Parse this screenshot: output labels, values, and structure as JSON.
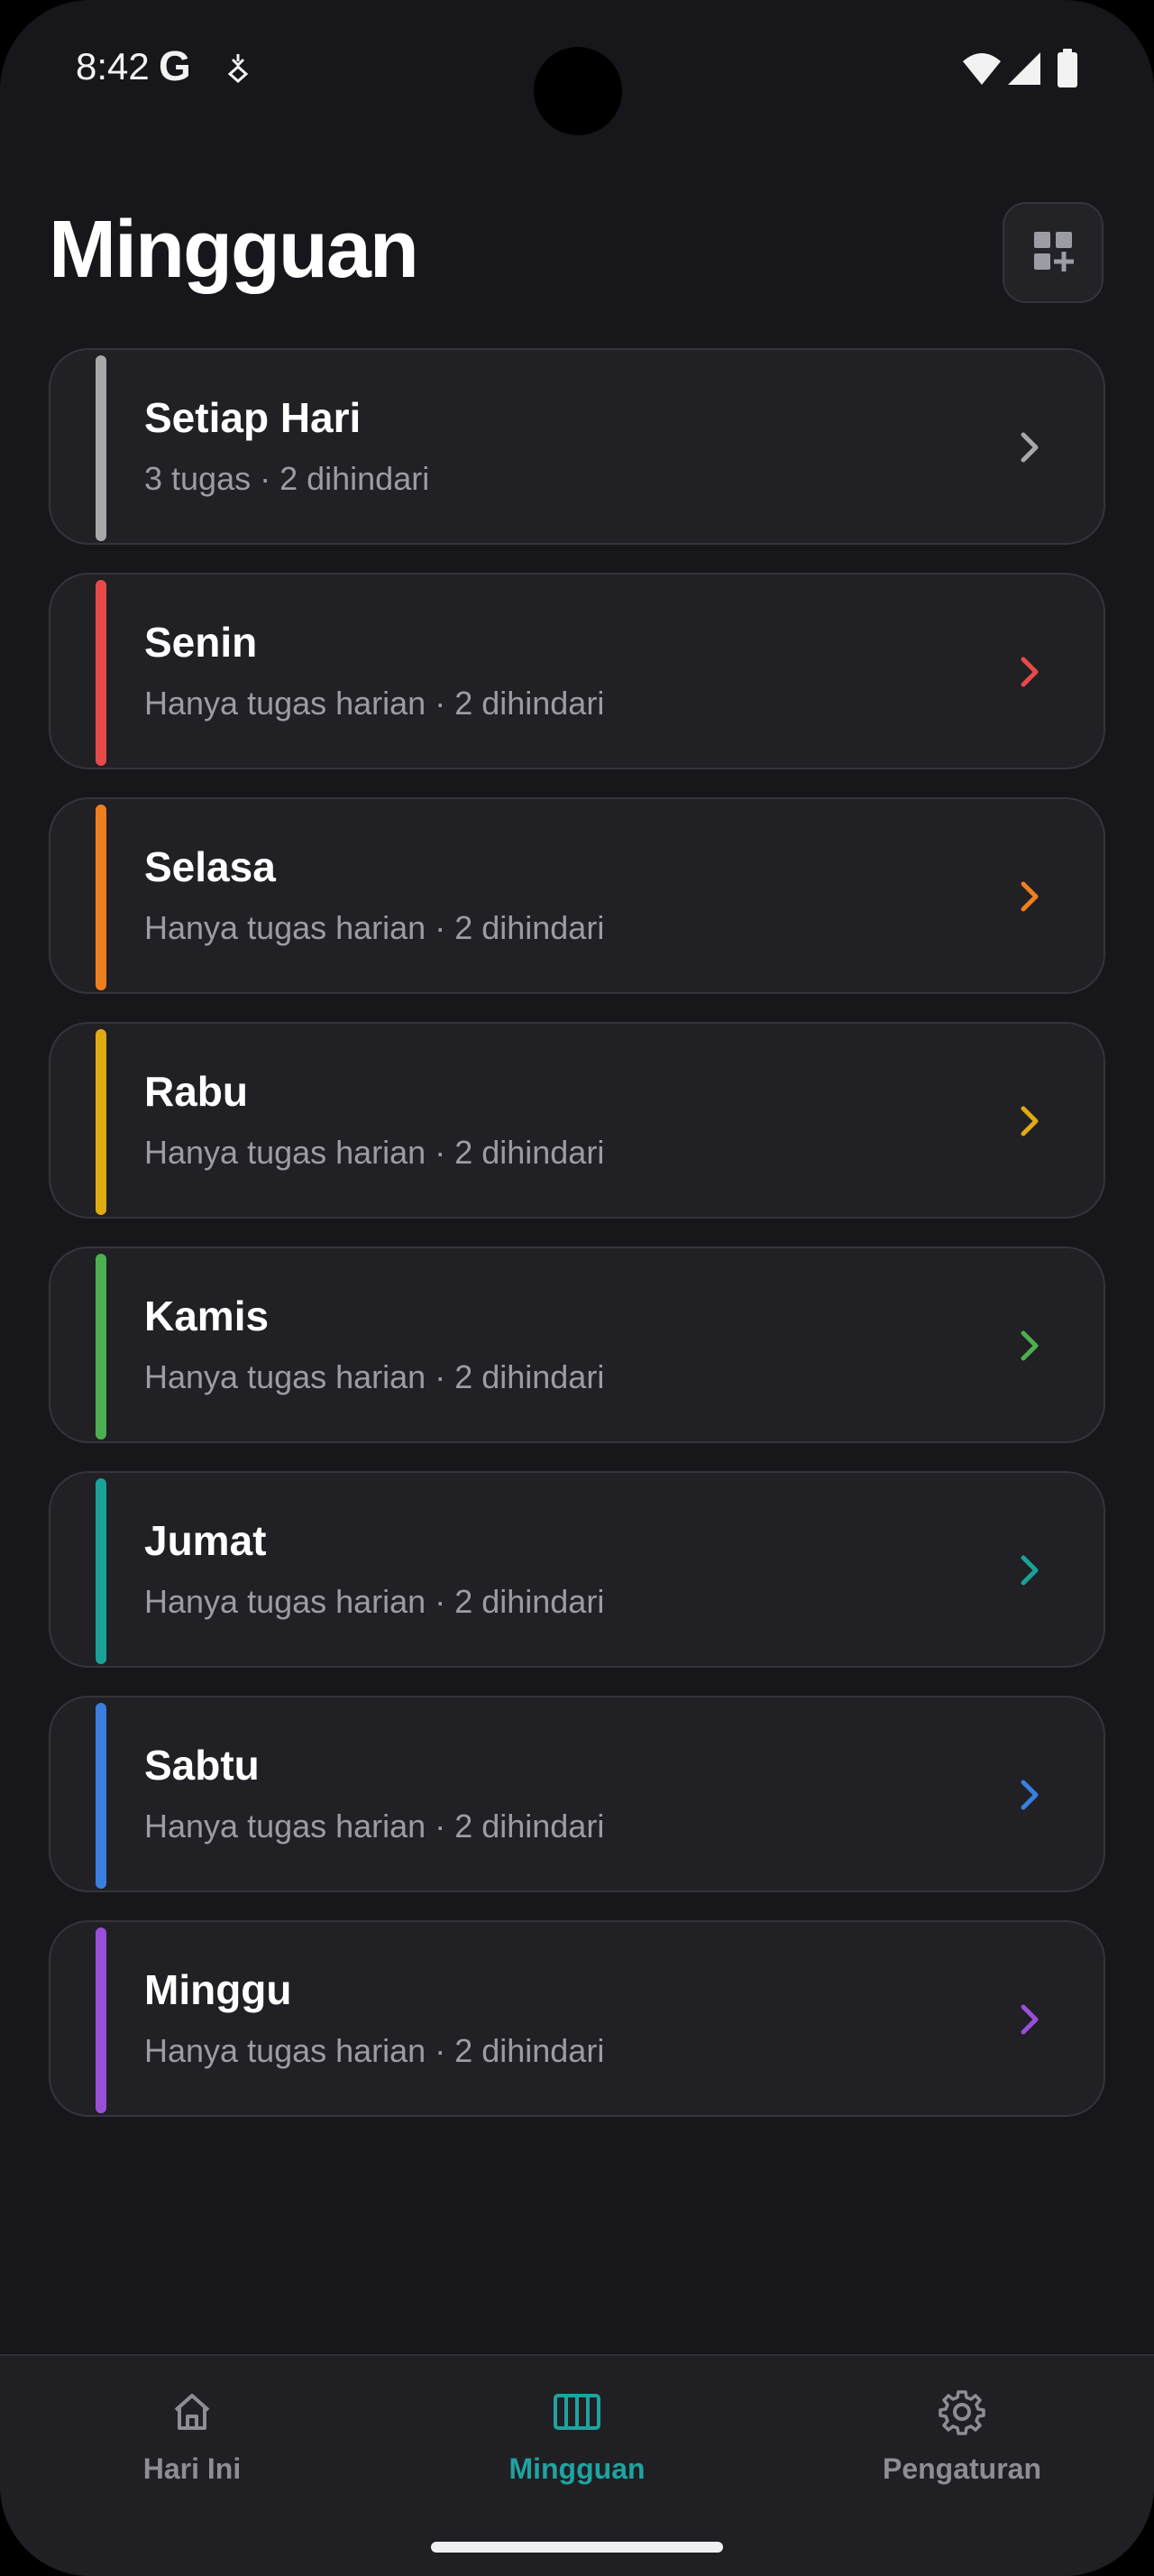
{
  "status_bar": {
    "time": "8:42",
    "google_icon": "G",
    "icons": [
      "google-icon",
      "notification-icon",
      "wifi-icon",
      "signal-icon",
      "battery-icon"
    ]
  },
  "header": {
    "title": "Mingguan",
    "action_icon": "add-widget-icon"
  },
  "days": [
    {
      "title": "Setiap Hari",
      "subtitle": "3 tugas · 2 dihindari",
      "color": "#a8a8a8"
    },
    {
      "title": "Senin",
      "subtitle": "Hanya tugas harian · 2 dihindari",
      "color": "#e84a4a"
    },
    {
      "title": "Selasa",
      "subtitle": "Hanya tugas harian · 2 dihindari",
      "color": "#ee7f1e"
    },
    {
      "title": "Rabu",
      "subtitle": "Hanya tugas harian · 2 dihindari",
      "color": "#e0aa12"
    },
    {
      "title": "Kamis",
      "subtitle": "Hanya tugas harian · 2 dihindari",
      "color": "#4caf50"
    },
    {
      "title": "Jumat",
      "subtitle": "Hanya tugas harian · 2 dihindari",
      "color": "#1aa198"
    },
    {
      "title": "Sabtu",
      "subtitle": "Hanya tugas harian · 2 dihindari",
      "color": "#3a7fe0"
    },
    {
      "title": "Minggu",
      "subtitle": "Hanya tugas harian · 2 dihindari",
      "color": "#9a4fd8"
    }
  ],
  "bottom_nav": {
    "items": [
      {
        "label": "Hari Ini",
        "icon": "home-icon",
        "active": false
      },
      {
        "label": "Mingguan",
        "icon": "week-columns-icon",
        "active": true
      },
      {
        "label": "Pengaturan",
        "icon": "gear-icon",
        "active": false
      }
    ],
    "active_color": "#1fa3a0",
    "inactive_color": "#8d8d94"
  }
}
